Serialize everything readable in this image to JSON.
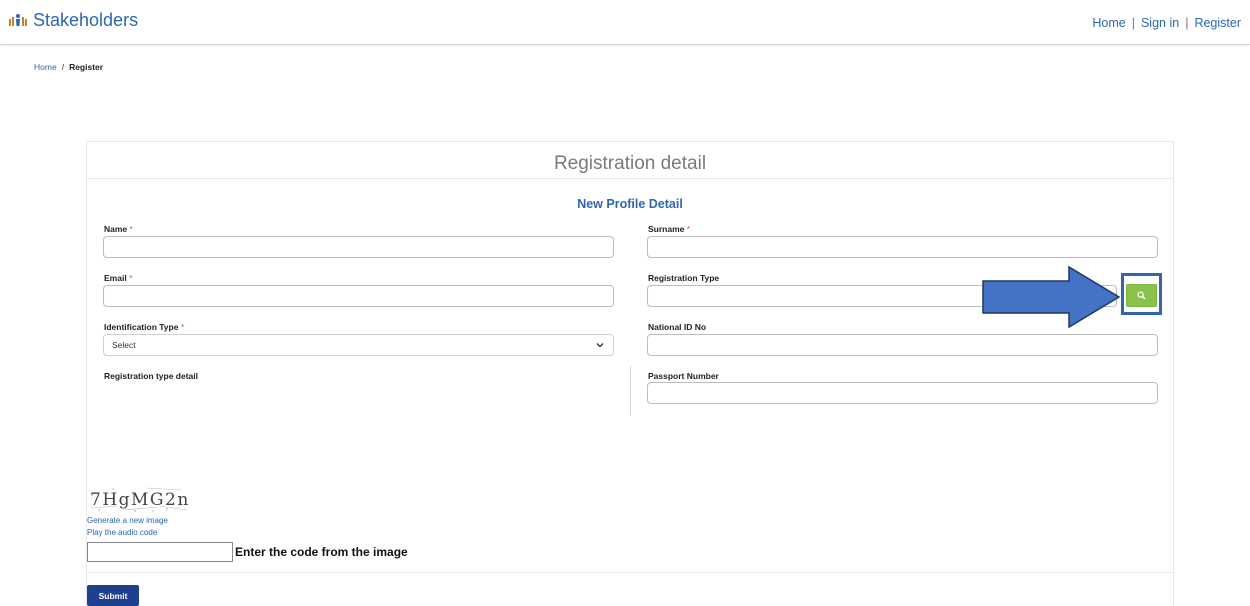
{
  "header": {
    "brand": "Stakeholders",
    "nav": [
      {
        "label": "Home"
      },
      {
        "label": "Sign in"
      },
      {
        "label": "Register"
      }
    ]
  },
  "breadcrumb": {
    "home": "Home",
    "separator": "/",
    "current": "Register"
  },
  "card": {
    "title": "Registration detail",
    "section_title": "New Profile Detail"
  },
  "form": {
    "name": {
      "label": "Name",
      "required_mark": "*",
      "value": ""
    },
    "surname": {
      "label": "Surname",
      "required_mark": "*",
      "value": ""
    },
    "email": {
      "label": "Email",
      "required_mark": "*",
      "value": ""
    },
    "registration_type": {
      "label": "Registration Type",
      "value": "",
      "search_icon": "search-icon"
    },
    "identification_type": {
      "label": "Identification Type",
      "required_mark": "*",
      "selected": "Select"
    },
    "national_id": {
      "label": "National ID No",
      "value": ""
    },
    "registration_type_detail": {
      "label": "Registration type detail"
    },
    "passport_number": {
      "label": "Passport Number",
      "value": ""
    }
  },
  "captcha": {
    "image_text": "7HgMG2n",
    "generate_link": "Generate a new image",
    "audio_link": "Play the audio code",
    "input_value": "",
    "instruction": "Enter the code from the image"
  },
  "actions": {
    "submit": "Submit"
  },
  "colors": {
    "brand_blue": "#2a67b5",
    "section_blue": "#2f66ad",
    "search_green": "#8bc34a",
    "submit_navy": "#1f3f8f",
    "required_red": "#d9534f",
    "annotation_arrow": "#4472c4"
  }
}
